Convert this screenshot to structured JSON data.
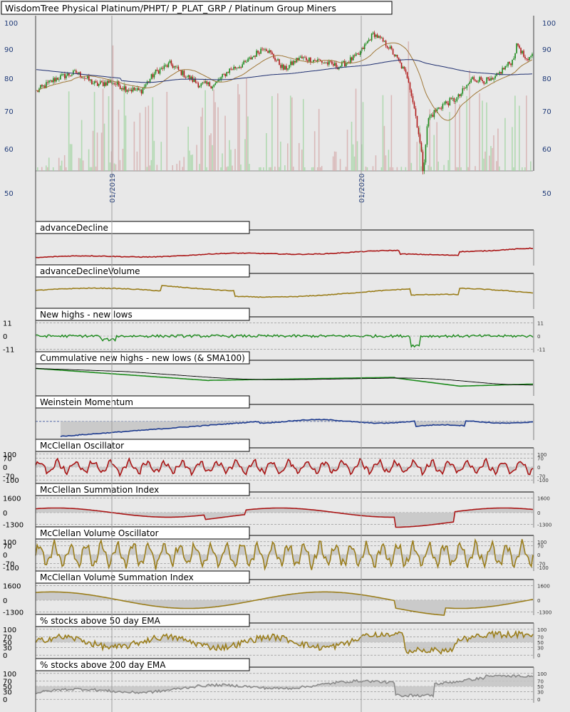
{
  "chart_data": {
    "type": "line",
    "title": "WisdomTree Physical Platinum/PHPT/ P_PLAT_GRP / Platinum Group Miners",
    "colors": {
      "background": "#e8e8e8",
      "grid": "#b0b0b0",
      "axis_text": "#1f3a78",
      "up_candle": "#1a8a1a",
      "down_candle": "#b01818",
      "ma_short": "#a07838",
      "ma_long": "#1f2f70",
      "red_line": "#aa1515",
      "gold_line": "#9a7d1a",
      "green_line": "#1b8a1b",
      "blue_line": "#1c3a8f",
      "gray_line": "#8a8a8a",
      "fill": "#c4c4c4"
    },
    "price": {
      "y_ticks": [
        50,
        60,
        70,
        80,
        90,
        100
      ],
      "ylim": [
        50,
        100
      ],
      "x_ticks": [
        "01/2019",
        "01/2020"
      ],
      "anchors": [
        [
          0,
          76
        ],
        [
          4,
          80
        ],
        [
          8,
          82
        ],
        [
          12,
          78
        ],
        [
          15,
          79
        ],
        [
          18,
          77
        ],
        [
          21,
          76
        ],
        [
          24,
          82
        ],
        [
          27,
          85
        ],
        [
          30,
          81
        ],
        [
          33,
          78
        ],
        [
          36,
          78
        ],
        [
          39,
          83
        ],
        [
          42,
          85
        ],
        [
          46,
          91
        ],
        [
          50,
          83
        ],
        [
          53,
          87
        ],
        [
          57,
          86
        ],
        [
          61,
          84
        ],
        [
          65,
          88
        ],
        [
          68,
          96
        ],
        [
          71,
          91
        ],
        [
          73,
          86
        ],
        [
          75,
          80
        ],
        [
          77,
          65
        ],
        [
          78,
          55
        ],
        [
          79,
          68
        ],
        [
          82,
          72
        ],
        [
          85,
          74
        ],
        [
          88,
          80
        ],
        [
          92,
          79
        ],
        [
          94,
          83
        ],
        [
          96,
          86
        ],
        [
          97,
          92
        ],
        [
          99,
          85
        ],
        [
          100,
          89
        ]
      ]
    },
    "panels": [
      {
        "title": "advanceDecline",
        "color": "red_line",
        "style": "line",
        "y_ticks": []
      },
      {
        "title": "advanceDeclineVolume",
        "color": "gold_line",
        "style": "line",
        "y_ticks": []
      },
      {
        "title": "New highs - new lows",
        "color": "green_line",
        "style": "line",
        "y_ticks": [
          11,
          0,
          -11
        ],
        "right_ticks": [
          11,
          0,
          -11
        ]
      },
      {
        "title": "Cummulative new highs - new lows (& SMA100)",
        "color": "green_line",
        "style": "line",
        "y_ticks": []
      },
      {
        "title": "Weinstein Momentum",
        "color": "blue_line",
        "style": "filled",
        "y_ticks": []
      },
      {
        "title": "McClellan Oscillator",
        "color": "red_line",
        "style": "filled",
        "y_ticks": [
          100,
          70,
          0,
          -70,
          -100
        ],
        "right_ticks": [
          100,
          70,
          0,
          -70,
          -100
        ]
      },
      {
        "title": "McClellan Summation Index",
        "color": "red_line",
        "style": "filled",
        "y_ticks": [
          1600,
          0,
          -1300
        ],
        "right_ticks": [
          1600,
          0,
          -1300
        ]
      },
      {
        "title": "McClellan Volume Oscillator",
        "color": "gold_line",
        "style": "filled",
        "y_ticks": [
          100,
          70,
          0,
          -70,
          -100
        ],
        "right_ticks": [
          100,
          70,
          0,
          -70,
          -100
        ]
      },
      {
        "title": "McClellan Volume Summation Index",
        "color": "gold_line",
        "style": "filled",
        "y_ticks": [
          1600,
          0,
          -1300
        ],
        "right_ticks": [
          1600,
          0,
          -1300
        ]
      },
      {
        "title": "% stocks above 50 day EMA",
        "color": "gold_line",
        "style": "filled",
        "y_ticks": [
          100,
          70,
          50,
          30,
          0
        ],
        "right_ticks": [
          100,
          70,
          50,
          30,
          0
        ]
      },
      {
        "title": "% stocks above 200 day EMA",
        "color": "gray_line",
        "style": "filled",
        "y_ticks": [
          100,
          70,
          50,
          30,
          0
        ],
        "right_ticks": [
          100,
          70,
          50,
          30,
          0
        ]
      }
    ]
  }
}
